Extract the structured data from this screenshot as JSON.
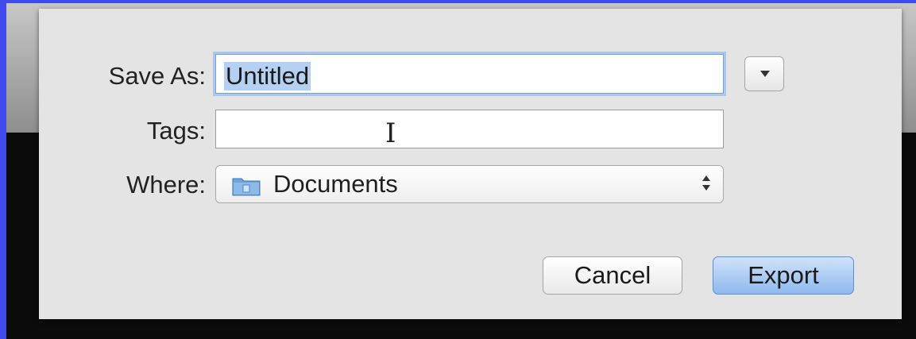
{
  "dialog": {
    "save_as_label": "Save As:",
    "save_as_value": "Untitled",
    "tags_label": "Tags:",
    "tags_value": "",
    "where_label": "Where:",
    "where_value": "Documents",
    "cancel_label": "Cancel",
    "export_label": "Export"
  },
  "icons": {
    "expand": "chevron-down-icon",
    "folder": "folder-icon",
    "stepper": "up-down-arrows-icon"
  },
  "colors": {
    "default_button": "#8fb9ee",
    "selection": "#b6d0f3",
    "focus_ring": "#a9c8f0",
    "folder": "#6fa3dc"
  }
}
